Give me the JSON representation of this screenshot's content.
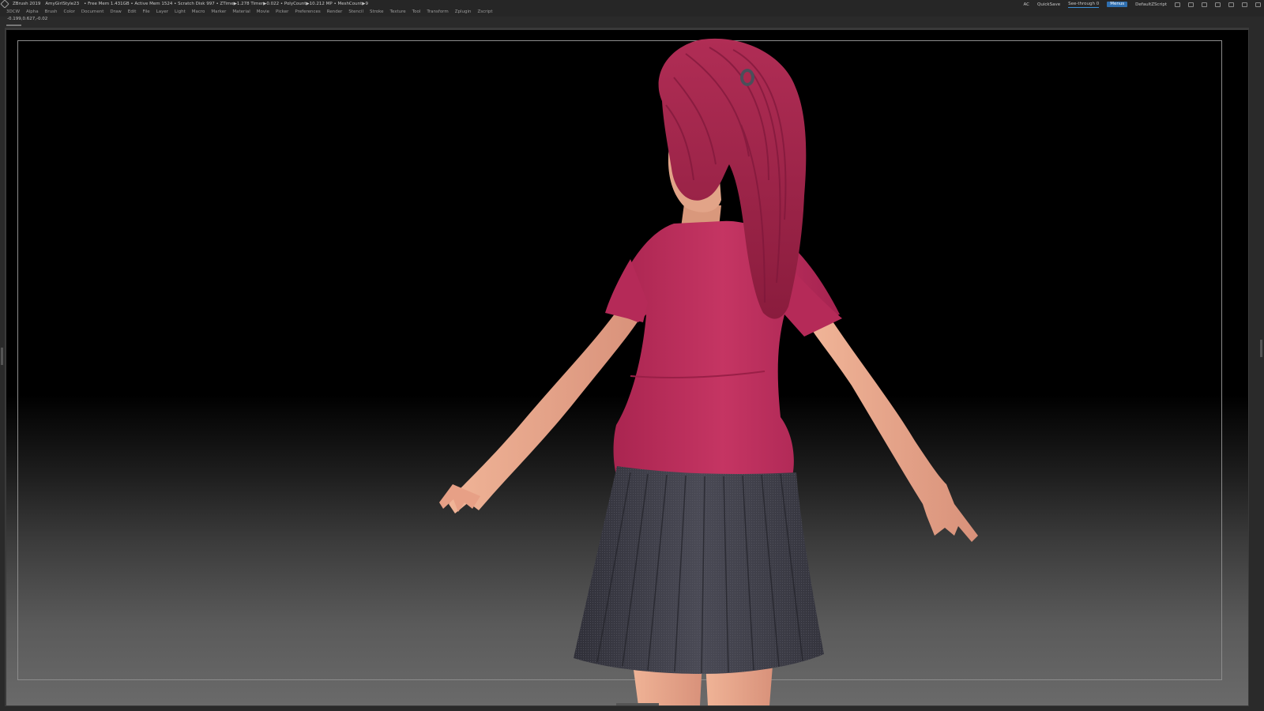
{
  "titlebar": {
    "app": "ZBrush 2019",
    "document": "AmyGirlStyle23",
    "stats": "• Free Mem 1.431GB • Active Mem 1524 • Scratch Disk 997 •  ZTime▶1.278 Timer▶0.022 • PolyCount▶10.212 MP  • MeshCount▶9",
    "ac": "AC",
    "quicksave": "QuickSave",
    "see_through": "See-through  0",
    "menus": "Menus",
    "script": "DefaultZScript"
  },
  "menubar": {
    "items": [
      "3DCW",
      "Alpha",
      "Brush",
      "Color",
      "Document",
      "Draw",
      "Edit",
      "File",
      "Layer",
      "Light",
      "Macro",
      "Marker",
      "Material",
      "Movie",
      "Picker",
      "Preferences",
      "Render",
      "Stencil",
      "Stroke",
      "Texture",
      "Tool",
      "Transform",
      "Zplugin",
      "Zscript"
    ]
  },
  "coords": "-0.199,0.627,-0.02",
  "colors": {
    "shirt": "#c3325f",
    "hair": "#a8284d",
    "skin": "#e9a98a",
    "skirt": "#3c3c46",
    "accent": "#2f6fb0"
  }
}
